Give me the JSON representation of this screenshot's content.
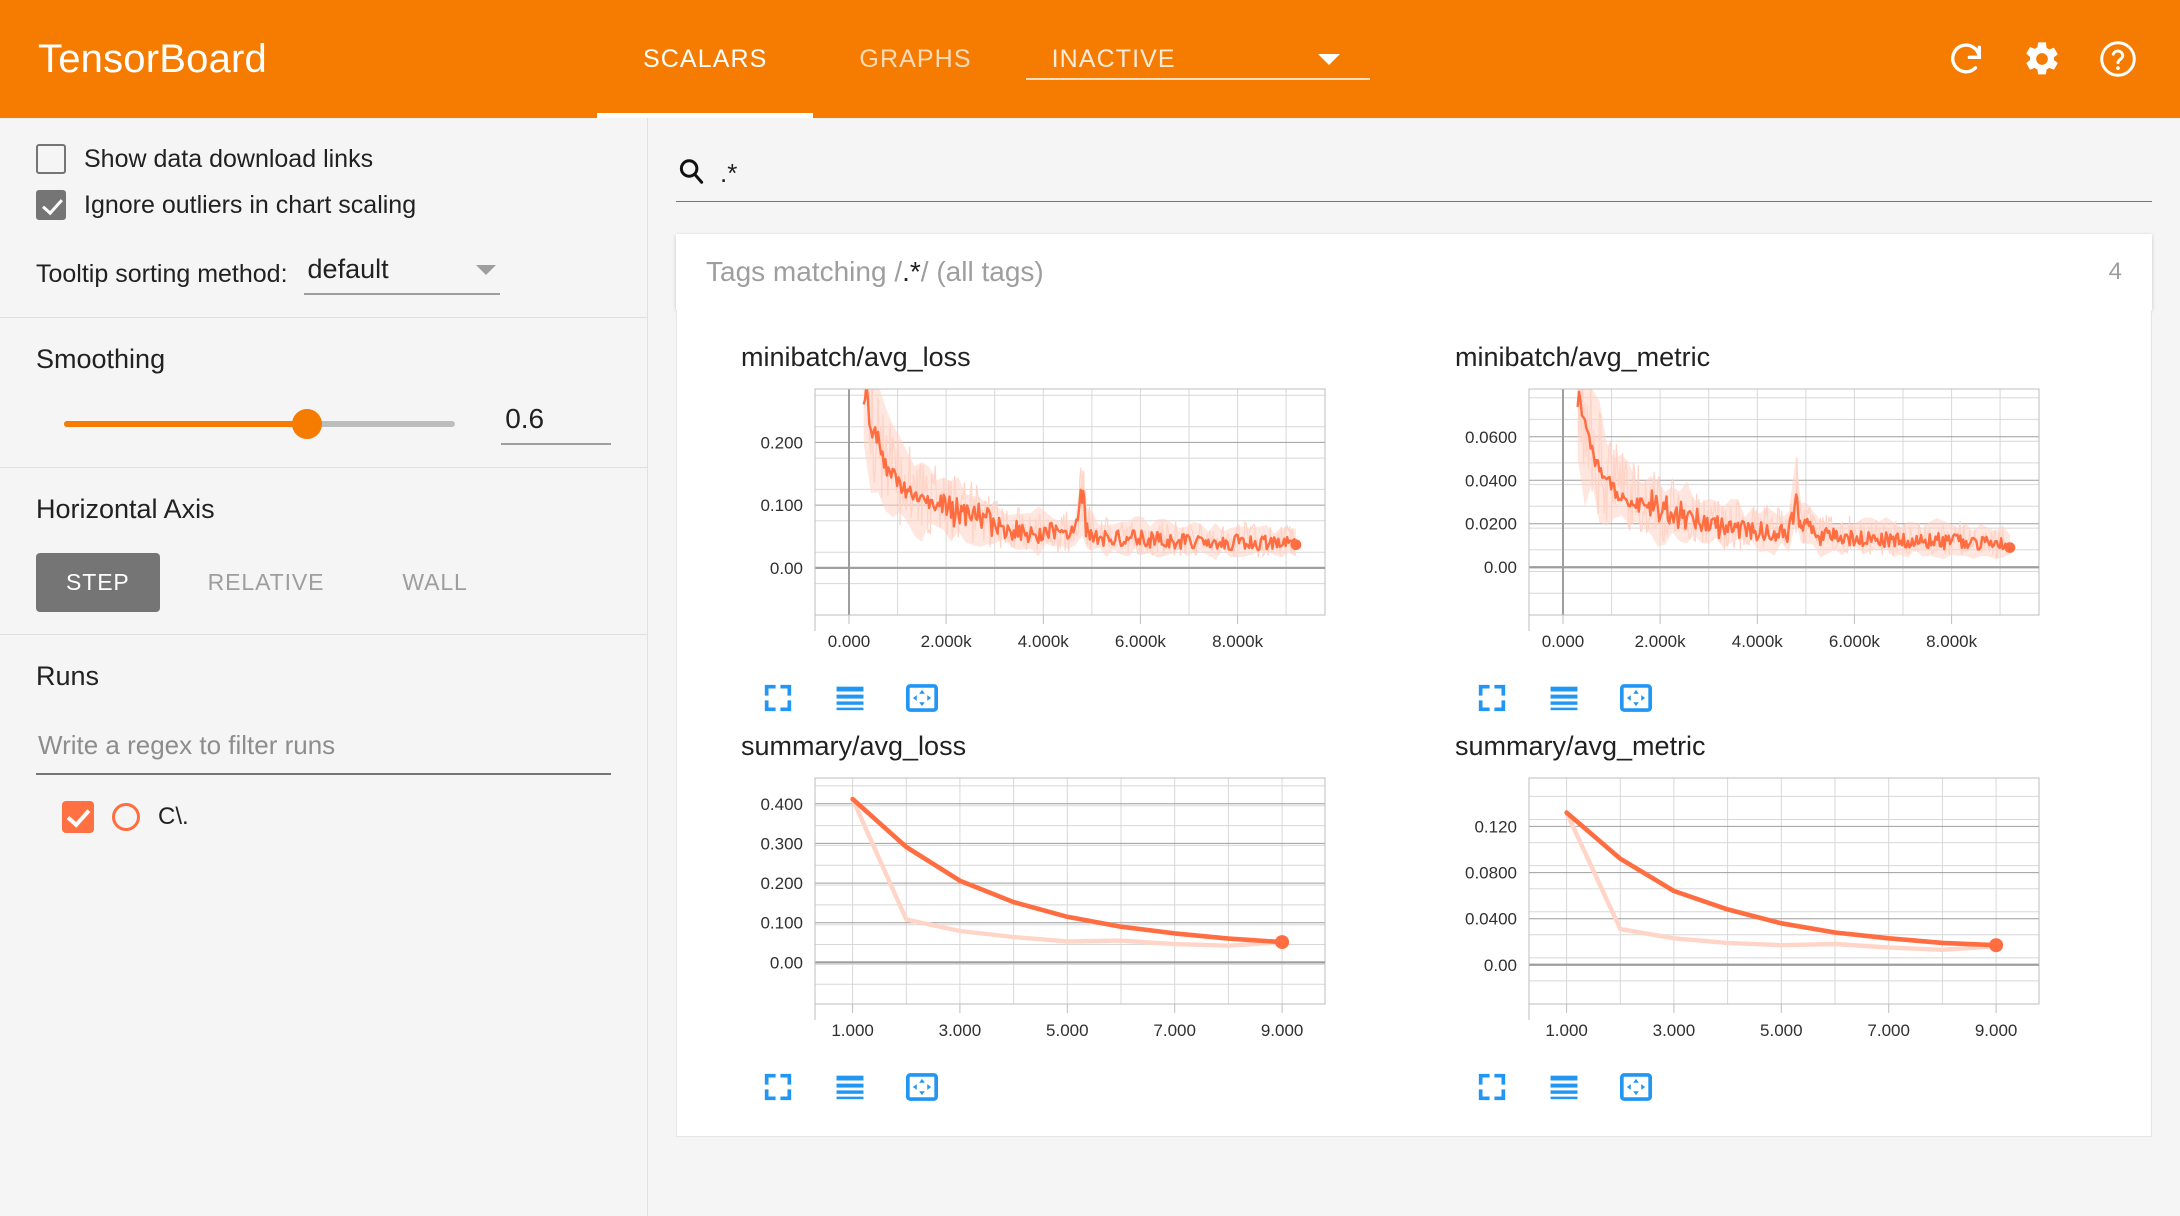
{
  "header": {
    "brand": "TensorBoard",
    "tabs": [
      {
        "label": "SCALARS",
        "active": true
      },
      {
        "label": "GRAPHS",
        "active": false
      }
    ],
    "inactive_dropdown": "INACTIVE",
    "icons": [
      {
        "name": "refresh-icon",
        "label": "Refresh"
      },
      {
        "name": "gear-icon",
        "label": "Settings"
      },
      {
        "name": "help-icon",
        "label": "Help"
      }
    ],
    "accent_color": "#f57c00"
  },
  "sidebar": {
    "checkboxes": [
      {
        "label": "Show data download links",
        "checked": false
      },
      {
        "label": "Ignore outliers in chart scaling",
        "checked": true
      }
    ],
    "tooltip_sorting": {
      "label": "Tooltip sorting method:",
      "value": "default"
    },
    "smoothing": {
      "title": "Smoothing",
      "value": "0.6",
      "percent": 62
    },
    "horizontal_axis": {
      "title": "Horizontal Axis",
      "options": [
        {
          "label": "STEP",
          "selected": true
        },
        {
          "label": "RELATIVE",
          "selected": false
        },
        {
          "label": "WALL",
          "selected": false
        }
      ]
    },
    "runs": {
      "title": "Runs",
      "filter_placeholder": "Write a regex to filter runs",
      "filter_value": "",
      "items": [
        {
          "name": "C\\.",
          "checked": true,
          "color": "#ff6d41"
        }
      ]
    }
  },
  "main": {
    "search": {
      "value": ".*",
      "icon": "search-icon"
    },
    "tags_card": {
      "prefix": "Tags matching /",
      "regex": ".*",
      "suffix": "/ (all tags)",
      "count": "4"
    },
    "chart_tools": [
      {
        "name": "expand-chart-icon"
      },
      {
        "name": "toggle-y-axis-icon"
      },
      {
        "name": "reset-zoom-icon"
      }
    ]
  },
  "chart_data": [
    {
      "type": "line",
      "title": "minibatch/avg_loss",
      "xlabel": "",
      "ylabel": "",
      "xticks": [
        "0.000",
        "2.000k",
        "4.000k",
        "6.000k",
        "8.000k"
      ],
      "xtick_values": [
        0,
        2000,
        4000,
        6000,
        8000
      ],
      "yticks": [
        "0.00",
        "0.100",
        "0.200"
      ],
      "ytick_values": [
        0.0,
        0.1,
        0.2
      ],
      "xlim": [
        -700,
        9800
      ],
      "ylim": [
        -0.075,
        0.285
      ],
      "grid": true,
      "legend": false,
      "smoothing": 0.6,
      "series": [
        {
          "name": "C\\. (smoothed)",
          "color": "#ff6d41",
          "x": [
            300,
            450,
            600,
            750,
            900,
            1050,
            1200,
            1350,
            1500,
            1650,
            1800,
            1950,
            2100,
            2250,
            2400,
            2550,
            2700,
            2850,
            3000,
            3150,
            3300,
            3450,
            3600,
            3750,
            3900,
            4050,
            4200,
            4350,
            4500,
            4650,
            4800,
            4900,
            5000,
            5150,
            5300,
            5450,
            5600,
            5750,
            5900,
            6050,
            6200,
            6350,
            6500,
            6650,
            6800,
            6950,
            7100,
            7250,
            7400,
            7550,
            7700,
            7850,
            8000,
            8150,
            8300,
            8450,
            8600,
            8750,
            8900,
            9050,
            9200
          ],
          "y": [
            0.29,
            0.232,
            0.197,
            0.168,
            0.148,
            0.131,
            0.122,
            0.116,
            0.108,
            0.101,
            0.1,
            0.095,
            0.092,
            0.088,
            0.086,
            0.082,
            0.08,
            0.074,
            0.066,
            0.062,
            0.06,
            0.058,
            0.059,
            0.057,
            0.056,
            0.054,
            0.056,
            0.054,
            0.052,
            0.053,
            0.112,
            0.06,
            0.056,
            0.05,
            0.047,
            0.048,
            0.046,
            0.045,
            0.047,
            0.046,
            0.044,
            0.045,
            0.043,
            0.044,
            0.042,
            0.043,
            0.041,
            0.042,
            0.04,
            0.041,
            0.042,
            0.04,
            0.041,
            0.043,
            0.04,
            0.039,
            0.04,
            0.039,
            0.038,
            0.038,
            0.037
          ],
          "end_marker": true
        },
        {
          "name": "C\\. (raw)",
          "color": "#ffd2c4",
          "opacity": 0.55
        }
      ]
    },
    {
      "type": "line",
      "title": "minibatch/avg_metric",
      "xlabel": "",
      "ylabel": "",
      "xticks": [
        "0.000",
        "2.000k",
        "4.000k",
        "6.000k",
        "8.000k"
      ],
      "xtick_values": [
        0,
        2000,
        4000,
        6000,
        8000
      ],
      "yticks": [
        "0.00",
        "0.0200",
        "0.0400",
        "0.0600"
      ],
      "ytick_values": [
        0.0,
        0.02,
        0.04,
        0.06
      ],
      "xlim": [
        -700,
        9800
      ],
      "ylim": [
        -0.022,
        0.082
      ],
      "grid": true,
      "legend": false,
      "smoothing": 0.6,
      "series": [
        {
          "name": "C\\. (smoothed)",
          "color": "#ff6d41",
          "x": [
            300,
            450,
            600,
            750,
            900,
            1050,
            1200,
            1350,
            1500,
            1650,
            1800,
            1950,
            2100,
            2250,
            2400,
            2550,
            2700,
            2850,
            3000,
            3150,
            3300,
            3450,
            3600,
            3750,
            3900,
            4050,
            4200,
            4350,
            4500,
            4650,
            4800,
            4900,
            5000,
            5150,
            5300,
            5450,
            5600,
            5750,
            5900,
            6050,
            6200,
            6350,
            6500,
            6650,
            6800,
            6950,
            7100,
            7250,
            7400,
            7550,
            7700,
            7850,
            8000,
            8150,
            8300,
            8450,
            8600,
            8750,
            8900,
            9050,
            9200
          ],
          "y": [
            0.082,
            0.063,
            0.052,
            0.0455,
            0.0395,
            0.036,
            0.033,
            0.0315,
            0.0295,
            0.028,
            0.0282,
            0.0268,
            0.0258,
            0.0245,
            0.024,
            0.023,
            0.0222,
            0.0205,
            0.0192,
            0.0185,
            0.0182,
            0.0178,
            0.018,
            0.0172,
            0.0168,
            0.016,
            0.0172,
            0.0164,
            0.0158,
            0.016,
            0.0335,
            0.019,
            0.0178,
            0.0155,
            0.0142,
            0.0148,
            0.0138,
            0.0132,
            0.014,
            0.0136,
            0.0128,
            0.0132,
            0.0126,
            0.013,
            0.0122,
            0.0126,
            0.0118,
            0.0122,
            0.0115,
            0.012,
            0.0124,
            0.0117,
            0.0121,
            0.0126,
            0.0116,
            0.0112,
            0.0116,
            0.0112,
            0.0106,
            0.0104,
            0.009
          ],
          "end_marker": true
        },
        {
          "name": "C\\. (raw)",
          "color": "#ffd2c4",
          "opacity": 0.55
        }
      ]
    },
    {
      "type": "line",
      "title": "summary/avg_loss",
      "xlabel": "",
      "ylabel": "",
      "xticks": [
        "1.000",
        "3.000",
        "5.000",
        "7.000",
        "9.000"
      ],
      "xtick_values": [
        1,
        3,
        5,
        7,
        9
      ],
      "yticks": [
        "0.00",
        "0.100",
        "0.200",
        "0.300",
        "0.400"
      ],
      "ytick_values": [
        0.0,
        0.1,
        0.2,
        0.3,
        0.4
      ],
      "xlim": [
        0.3,
        9.8
      ],
      "ylim": [
        -0.105,
        0.465
      ],
      "grid": true,
      "legend": false,
      "smoothing": 0.6,
      "series": [
        {
          "name": "C\\. (smoothed)",
          "color": "#ff6d41",
          "x": [
            1,
            2,
            3,
            4,
            5,
            6,
            7,
            8,
            9
          ],
          "y": [
            0.412,
            0.291,
            0.206,
            0.152,
            0.115,
            0.09,
            0.073,
            0.06,
            0.051
          ],
          "end_marker": true
        },
        {
          "name": "C\\. (raw)",
          "color": "#ffd5c8",
          "x": [
            1,
            2,
            3,
            4,
            5,
            6,
            7,
            8,
            9
          ],
          "y": [
            0.412,
            0.108,
            0.079,
            0.064,
            0.053,
            0.055,
            0.046,
            0.042,
            0.051
          ],
          "opacity": 1
        }
      ]
    },
    {
      "type": "line",
      "title": "summary/avg_metric",
      "xlabel": "",
      "ylabel": "",
      "xticks": [
        "1.000",
        "3.000",
        "5.000",
        "7.000",
        "9.000"
      ],
      "xtick_values": [
        1,
        3,
        5,
        7,
        9
      ],
      "yticks": [
        "0.00",
        "0.0400",
        "0.0800",
        "0.120"
      ],
      "ytick_values": [
        0.0,
        0.04,
        0.08,
        0.12
      ],
      "xlim": [
        0.3,
        9.8
      ],
      "ylim": [
        -0.034,
        0.162
      ],
      "grid": true,
      "legend": false,
      "smoothing": 0.6,
      "series": [
        {
          "name": "C\\. (smoothed)",
          "color": "#ff6d41",
          "x": [
            1,
            2,
            3,
            4,
            5,
            6,
            7,
            8,
            9
          ],
          "y": [
            0.132,
            0.092,
            0.064,
            0.048,
            0.036,
            0.028,
            0.023,
            0.019,
            0.017
          ],
          "end_marker": true
        },
        {
          "name": "C\\. (raw)",
          "color": "#ffd5c8",
          "x": [
            1,
            2,
            3,
            4,
            5,
            6,
            7,
            8,
            9
          ],
          "y": [
            0.132,
            0.031,
            0.023,
            0.019,
            0.017,
            0.018,
            0.015,
            0.013,
            0.016
          ],
          "opacity": 1
        }
      ]
    }
  ]
}
